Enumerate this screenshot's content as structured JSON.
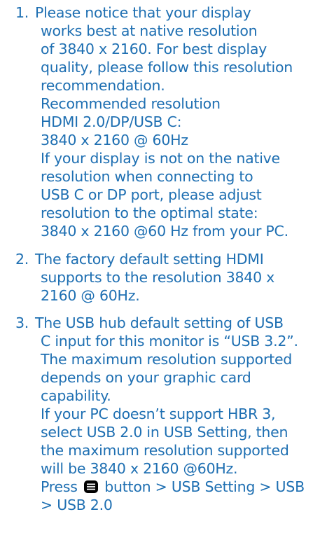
{
  "items": [
    {
      "number": "1.",
      "lines": [
        "Please notice that your display",
        "works best at native resolution",
        "of 3840 x 2160. For best display",
        "quality, please follow this resolution",
        "recommendation.",
        "Recommended resolution",
        "HDMI 2.0/DP/USB C:",
        "3840 x 2160 @ 60Hz",
        "If your display is not on the native",
        "resolution when connecting to",
        "USB C or DP port, please adjust",
        "resolution to the optimal state:",
        "3840 x 2160 @60 Hz from your PC."
      ]
    },
    {
      "number": "2.",
      "lines": [
        "The factory default setting HDMI",
        "supports to the resolution 3840 x",
        "2160 @ 60Hz."
      ]
    },
    {
      "number": "3.",
      "lines": [
        "The USB hub default setting of USB",
        "C input for this monitor is “USB 3.2”.",
        "The maximum resolution supported",
        "depends on your graphic card",
        "capability.",
        "If your PC doesn’t support HBR 3,",
        "select USB 2.0 in USB Setting, then",
        "the maximum resolution supported",
        "will be 3840 x 2160 @60Hz."
      ],
      "press_line": {
        "before": "Press",
        "icon": "menu-button-icon",
        "after": "button > USB Setting > USB"
      },
      "last_line": "> USB 2.0"
    }
  ]
}
